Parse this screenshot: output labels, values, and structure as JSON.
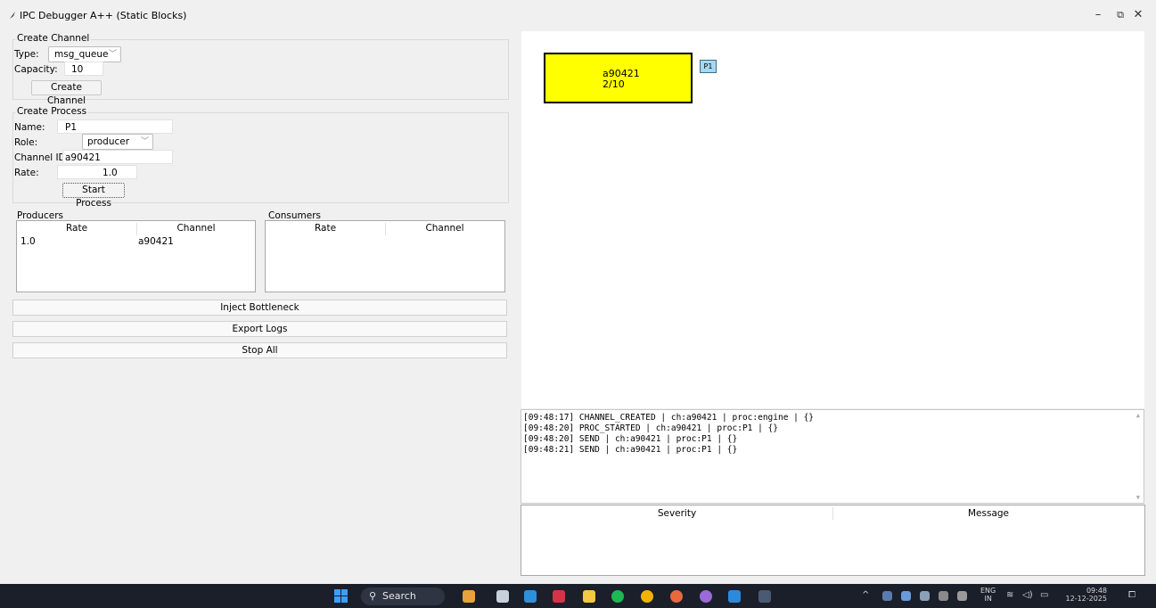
{
  "window": {
    "title": "IPC Debugger A++ (Static Blocks)",
    "minimize": "–",
    "restore": "⧉",
    "close": "✕"
  },
  "create_channel": {
    "group_title": "Create Channel",
    "type_label": "Type:",
    "type_value": "msg_queue",
    "capacity_label": "Capacity:",
    "capacity_value": "10",
    "button": "Create Channel"
  },
  "create_process": {
    "group_title": "Create Process",
    "name_label": "Name:",
    "name_value": "P1",
    "role_label": "Role:",
    "role_value": "producer",
    "channel_label": "Channel ID:",
    "channel_value": "a90421",
    "rate_label": "Rate:",
    "rate_value": "1.0",
    "button": "Start Process"
  },
  "producers": {
    "title": "Producers",
    "columns": [
      "Rate",
      "Channel"
    ],
    "rows": [
      [
        "1.0",
        "a90421"
      ]
    ]
  },
  "consumers": {
    "title": "Consumers",
    "columns": [
      "Rate",
      "Channel"
    ],
    "rows": []
  },
  "actions": {
    "inject": "Inject Bottleneck",
    "export": "Export Logs",
    "stop": "Stop All"
  },
  "canvas": {
    "channel_id": "a90421",
    "channel_fill": "2/10",
    "process_label": "P1",
    "channel_color": "#ffff00",
    "process_color": "#a8d8f0"
  },
  "log": [
    "[09:48:17] CHANNEL_CREATED | ch:a90421 | proc:engine | {}",
    "[09:48:20] PROC_STARTED | ch:a90421 | proc:P1 | {}",
    "[09:48:20] SEND | ch:a90421 | proc:P1 | {}",
    "[09:48:21] SEND | ch:a90421 | proc:P1 | {}"
  ],
  "severity_table": {
    "columns": [
      "Severity",
      "Message"
    ]
  },
  "taskbar": {
    "search": "Search",
    "lang": "ENG",
    "region": "IN",
    "time": "09:48",
    "date": "12-12-2025"
  }
}
